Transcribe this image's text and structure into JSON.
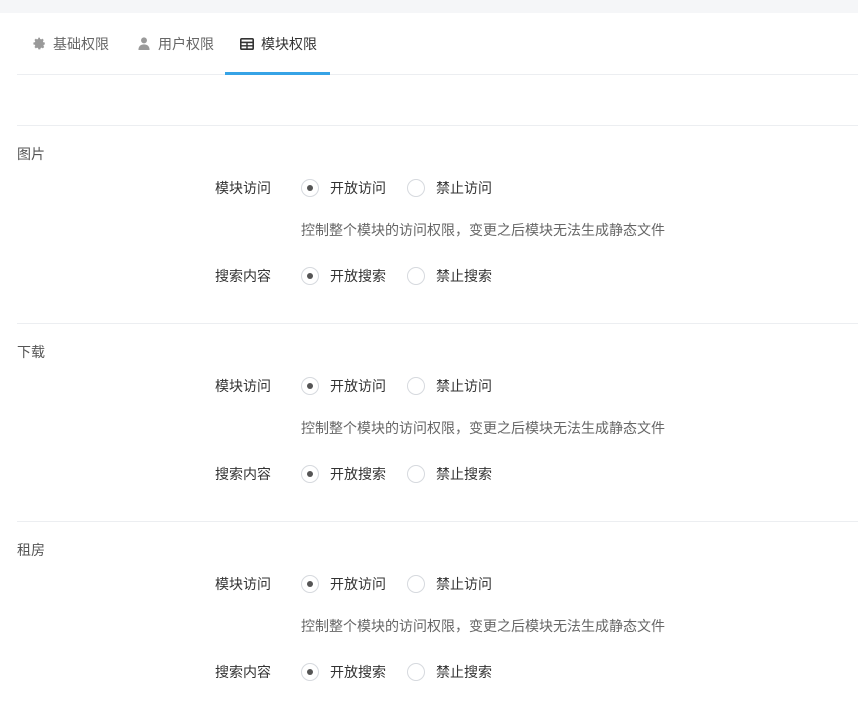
{
  "tabs": [
    {
      "label": "基础权限",
      "icon": "gear-icon",
      "active": false
    },
    {
      "label": "用户权限",
      "icon": "user-icon",
      "active": false
    },
    {
      "label": "模块权限",
      "icon": "table-icon",
      "active": true
    }
  ],
  "sections": [
    {
      "title": "图片",
      "access_label": "模块访问",
      "access_open": "开放访问",
      "access_forbid": "禁止访问",
      "access_selected": "开放访问",
      "help": "控制整个模块的访问权限，变更之后模块无法生成静态文件",
      "search_label": "搜索内容",
      "search_open": "开放搜索",
      "search_forbid": "禁止搜索",
      "search_selected": "开放搜索"
    },
    {
      "title": "下载",
      "access_label": "模块访问",
      "access_open": "开放访问",
      "access_forbid": "禁止访问",
      "access_selected": "开放访问",
      "help": "控制整个模块的访问权限，变更之后模块无法生成静态文件",
      "search_label": "搜索内容",
      "search_open": "开放搜索",
      "search_forbid": "禁止搜索",
      "search_selected": "开放搜索"
    },
    {
      "title": "租房",
      "access_label": "模块访问",
      "access_open": "开放访问",
      "access_forbid": "禁止访问",
      "access_selected": "开放访问",
      "help": "控制整个模块的访问权限，变更之后模块无法生成静态文件",
      "search_label": "搜索内容",
      "search_open": "开放搜索",
      "search_forbid": "禁止搜索",
      "search_selected": "开放搜索"
    }
  ],
  "colors": {
    "accent": "#36a3e6",
    "divider": "#eceef1"
  }
}
